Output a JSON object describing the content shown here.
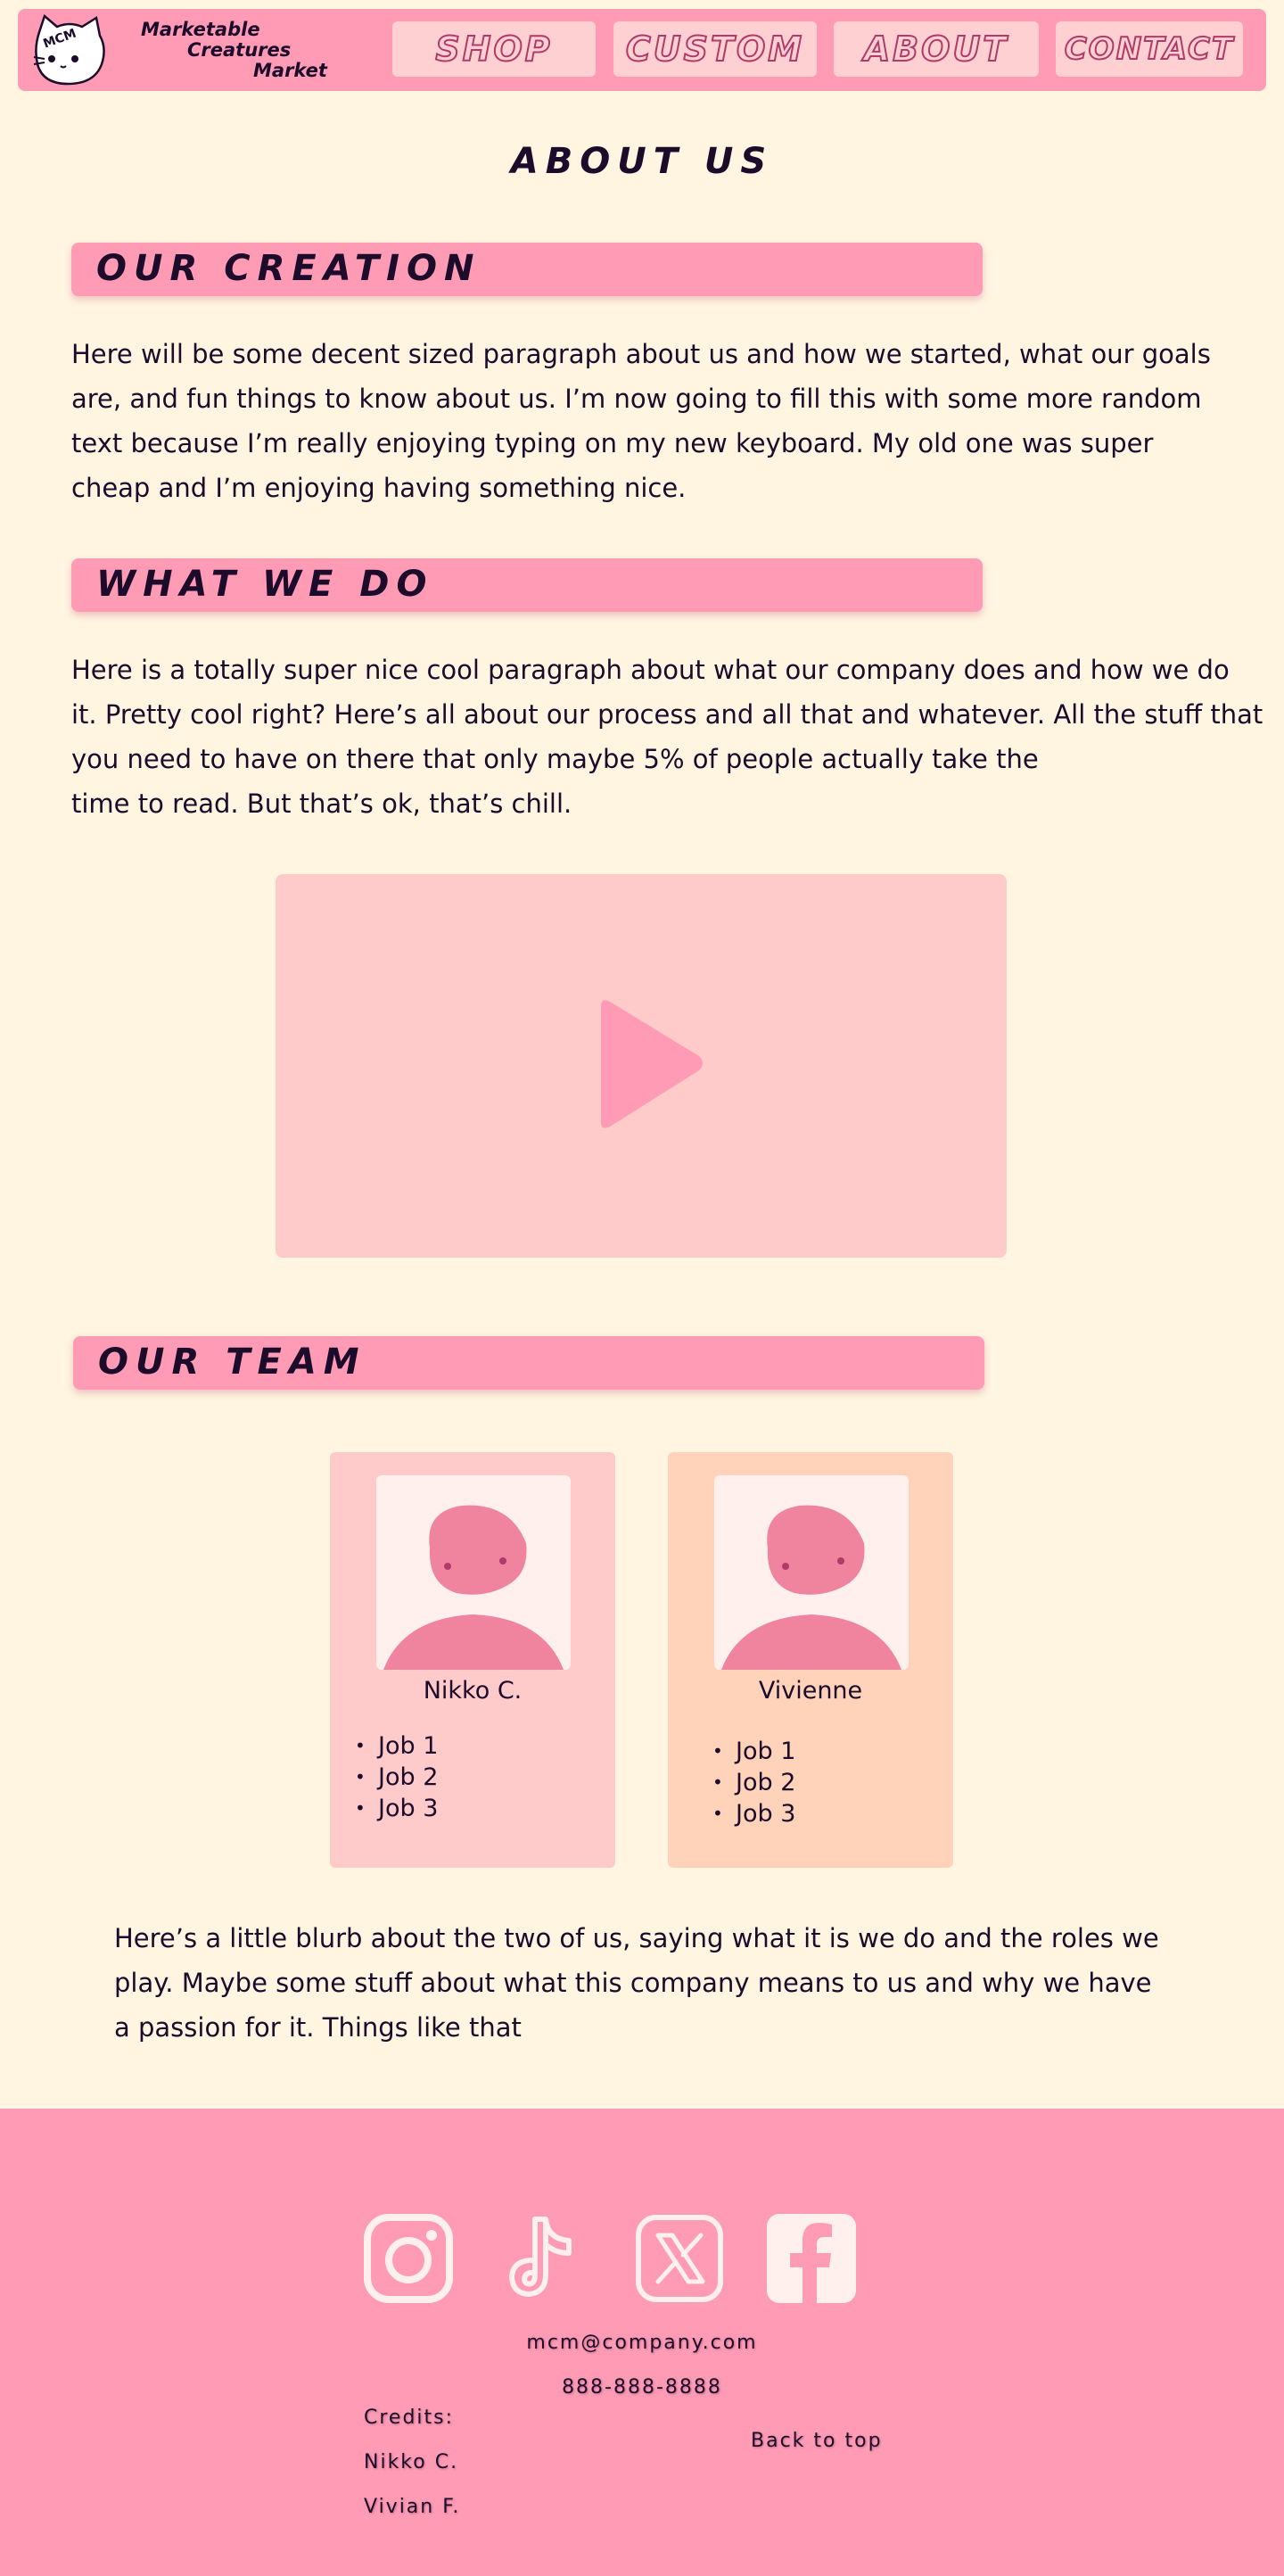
{
  "nav": {
    "logo_badge": "MCM",
    "logo_lines": [
      "Marketable",
      "Creatures",
      "Market"
    ],
    "items": [
      {
        "label": "SHOP"
      },
      {
        "label": "CUSTOM"
      },
      {
        "label": "ABOUT"
      },
      {
        "label": "CONTACT"
      }
    ]
  },
  "page": {
    "title": "ABOUT US"
  },
  "sections": {
    "creation": {
      "heading": "OUR CREATION",
      "text": "Here will be some decent sized paragraph about us and how we started, what our goals are, and fun things to know about us. I’m now going to fill this with some more random text because I’m really enjoying typing on my new keyboard. My old one was super cheap and I’m enjoying having something nice."
    },
    "what_we_do": {
      "heading": "WHAT WE DO",
      "text_lines": [
        "Here is a totally super nice cool paragraph about what our company does and how we do",
        "it. Pretty cool right? Here’s all about our process and all that and whatever. All the stuff that",
        "you need to have on there that only maybe 5% of people actually take the",
        "time to read. But that’s ok, that’s chill."
      ]
    },
    "team": {
      "heading": "OUR TEAM",
      "members": [
        {
          "name": "Nikko C.",
          "jobs": [
            "Job 1",
            "Job 2",
            "Job 3"
          ]
        },
        {
          "name": "Vivienne",
          "jobs": [
            "Job 1",
            "Job 2",
            "Job 3"
          ]
        }
      ],
      "blurb_lines": [
        "Here’s a little blurb about the two of us, saying what it is we do and the roles we",
        "play. Maybe some stuff about what this company means to us and why we have",
        "a passion for it. Things like that"
      ]
    }
  },
  "footer": {
    "socials": [
      {
        "icon": "instagram-icon"
      },
      {
        "icon": "tiktok-icon"
      },
      {
        "icon": "x-icon"
      },
      {
        "icon": "facebook-icon"
      }
    ],
    "email": "mcm@company.com",
    "phone": "888-888-8888",
    "credits_label": "Credits:",
    "credits": [
      "Nikko C.",
      "Vivian F."
    ],
    "back_to_top": "Back to top"
  },
  "colors": {
    "background": "#fff5e1",
    "pink": "#ff9bb5",
    "light_pink": "#ffcaca",
    "peach": "#ffd3ba",
    "text": "#1c0b2b"
  }
}
